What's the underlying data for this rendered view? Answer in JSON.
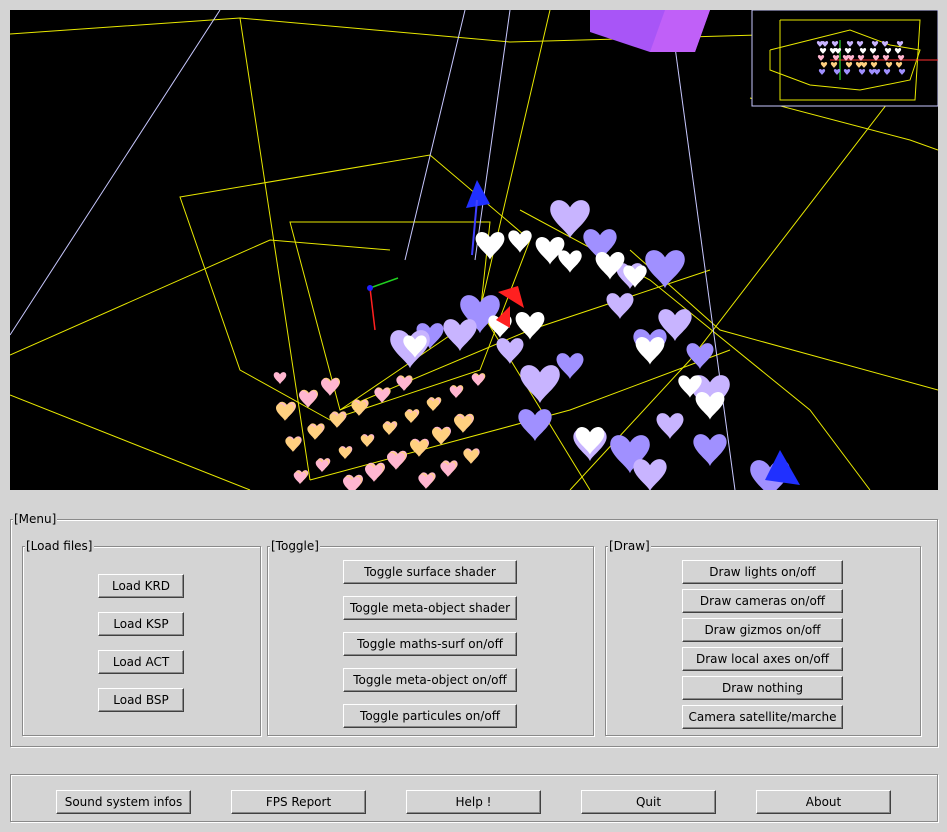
{
  "menu": {
    "title": "[Menu]",
    "load_files": {
      "title": "[Load files]",
      "buttons": [
        "Load KRD",
        "Load KSP",
        "Load ACT",
        "Load BSP"
      ]
    },
    "toggle": {
      "title": "[Toggle]",
      "buttons": [
        "Toggle surface shader",
        "Toggle meta-object shader",
        "Toggle maths-surf on/off",
        "Toggle meta-object on/off",
        "Toggle particules on/off"
      ]
    },
    "draw": {
      "title": "[Draw]",
      "buttons": [
        "Draw lights on/off",
        "Draw cameras on/off",
        "Draw gizmos on/off",
        "Draw local axes on/off",
        "Draw nothing",
        "Camera satellite/marche"
      ]
    }
  },
  "bottom_bar": {
    "buttons": [
      "Sound system infos",
      "FPS Report",
      "Help !",
      "Quit",
      "About"
    ]
  },
  "viewport": {
    "background": "#000000",
    "wire_color": "#e8e800",
    "line_color": "#c8c8ff",
    "heart_colors": [
      "#c8b4ff",
      "#ffffff",
      "#ffb6d0",
      "#ffd080",
      "#a090ff"
    ],
    "cube_color": "#a855f7",
    "axis_colors": {
      "x": "#ff2020",
      "y": "#20d020",
      "z": "#2020ff"
    }
  }
}
